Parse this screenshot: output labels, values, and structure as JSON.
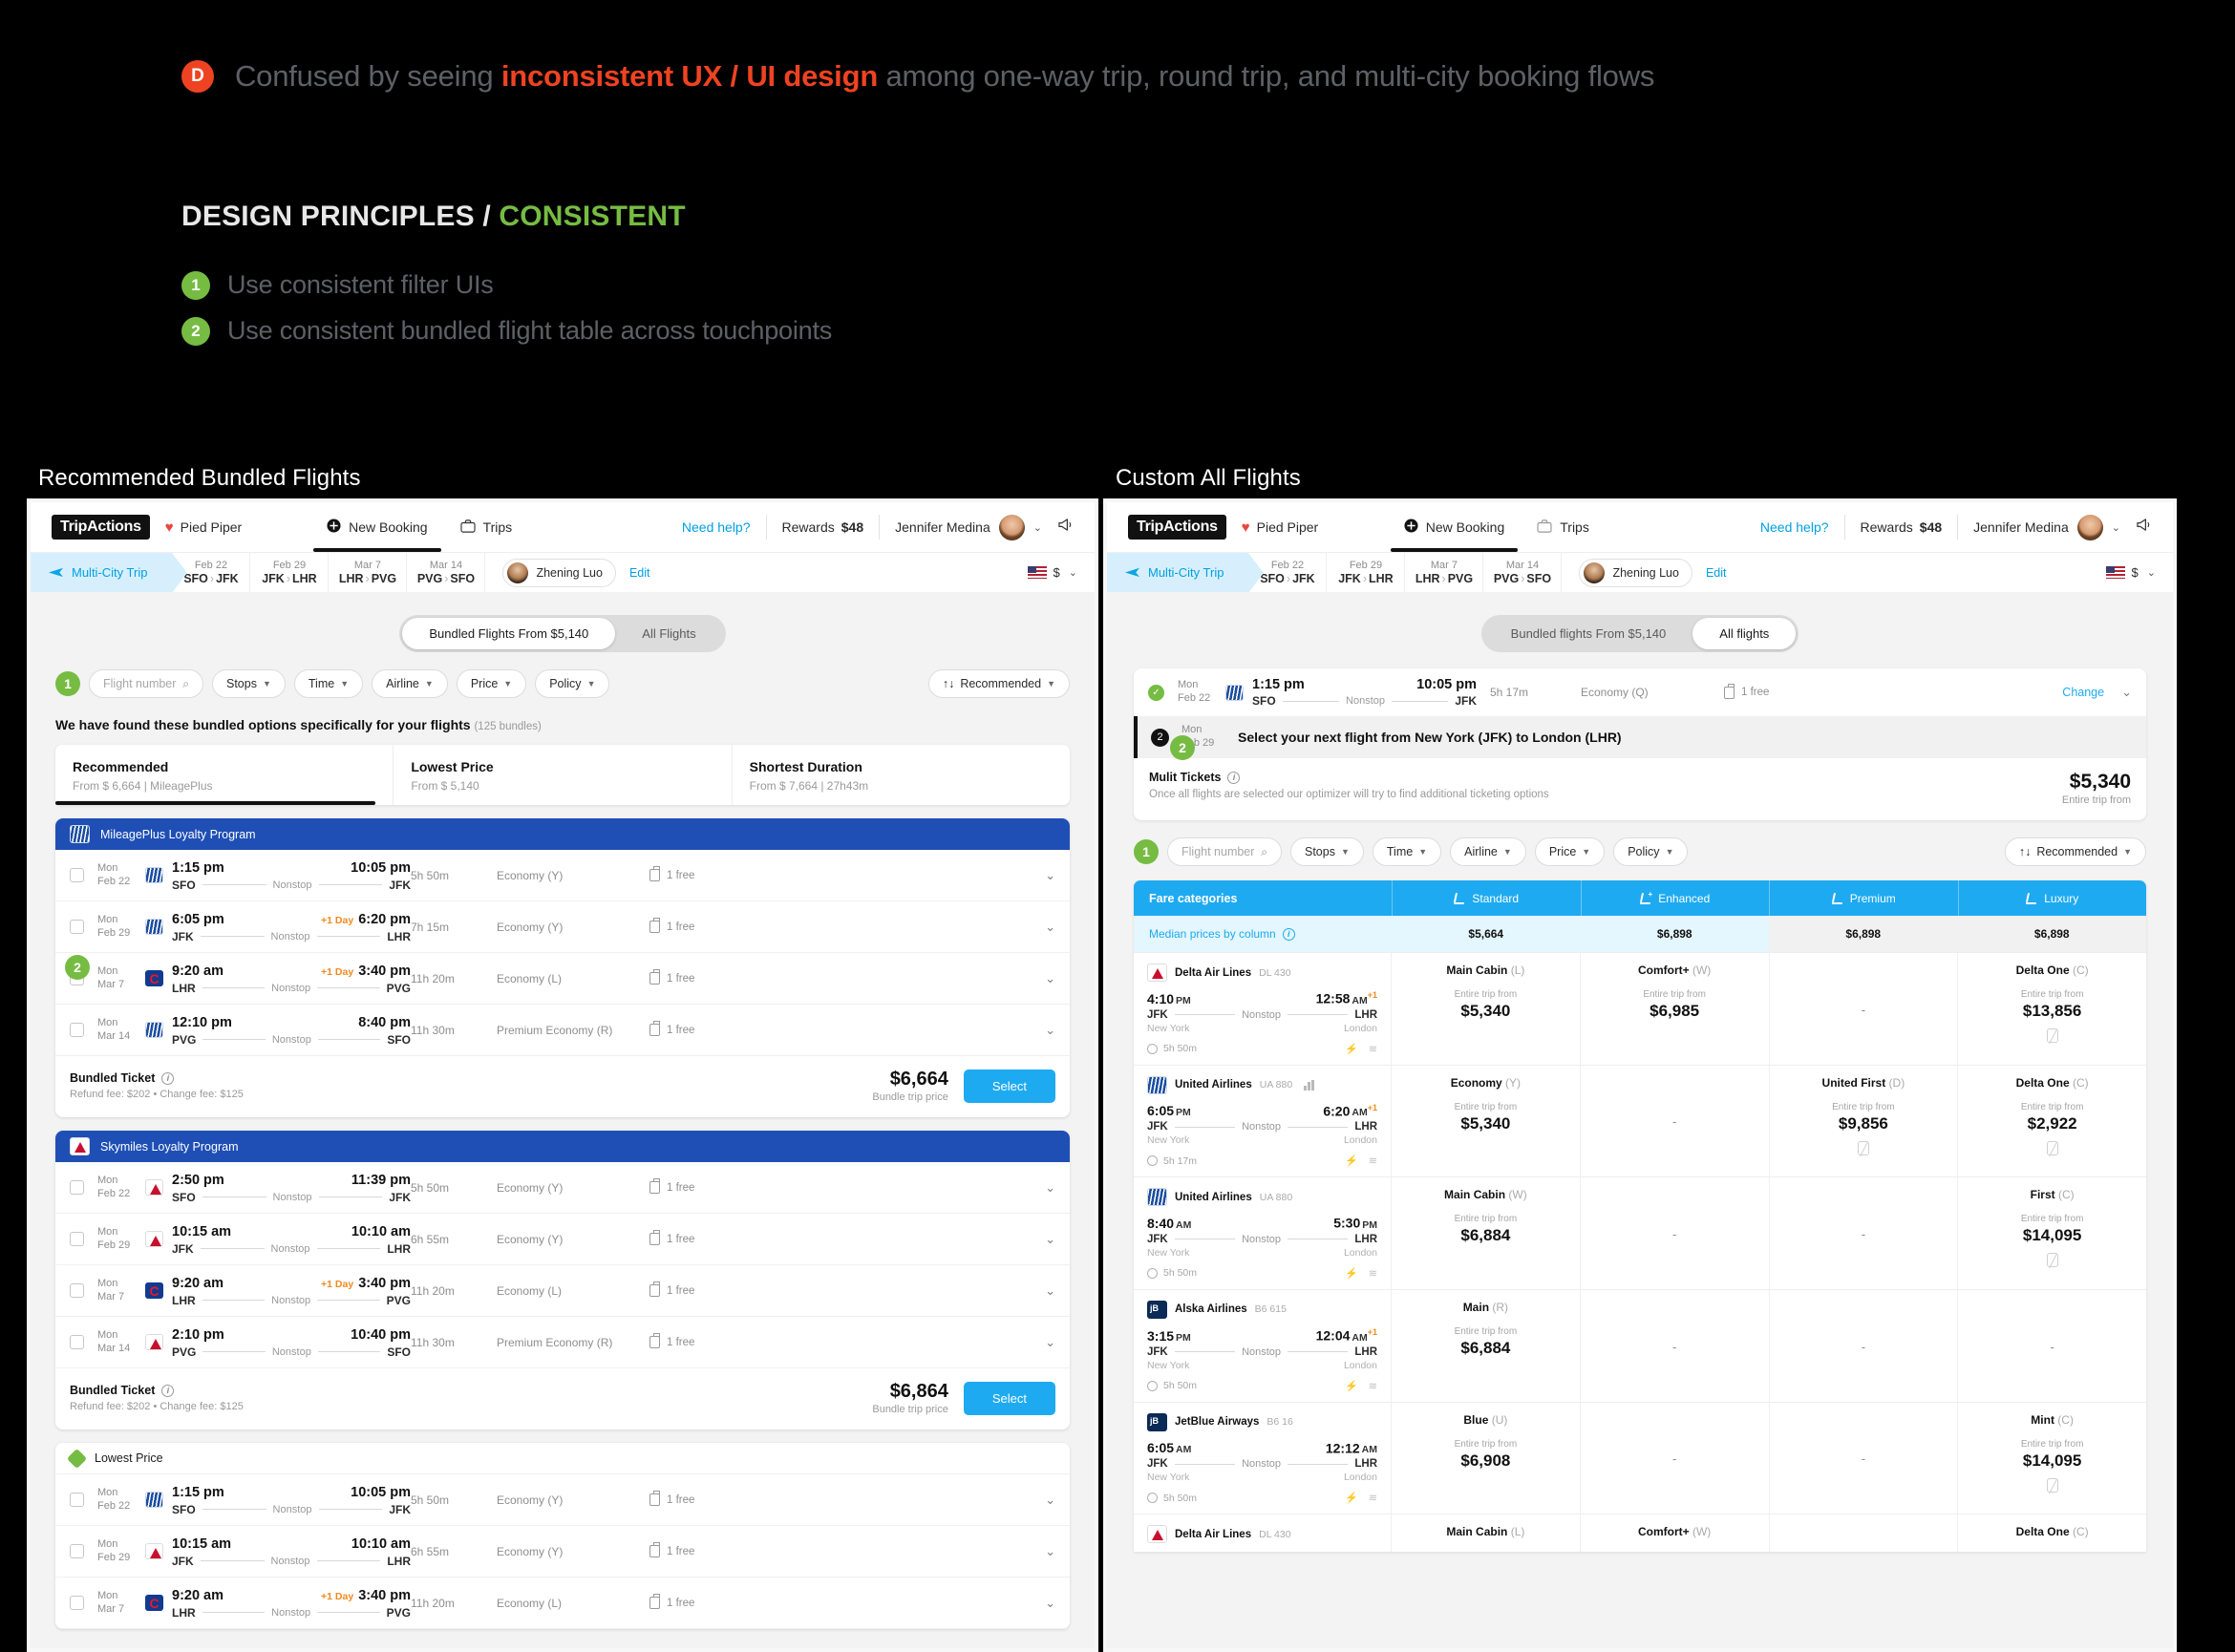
{
  "pain_point": {
    "badge": "D",
    "before": "Confused by seeing ",
    "highlight": "inconsistent UX / UI design",
    "after": " among one-way trip, round trip, and multi-city booking flows"
  },
  "design_principles": {
    "title_prefix": "DESIGN PRINCIPLES / ",
    "title_accent": "CONSISTENT",
    "items": [
      {
        "num": "1",
        "label": "Use consistent filter UIs"
      },
      {
        "num": "2",
        "label": "Use consistent bundled flight table across touchpoints"
      }
    ]
  },
  "captions": {
    "left": "Recommended Bundled Flights",
    "right": "Custom All Flights"
  },
  "colors": {
    "accent_blue": "#1eaaf1",
    "link_blue": "#00a0e3",
    "brand_red": "#ee4322",
    "green": "#76bc43",
    "header_blue": "#1f4fb5",
    "orange": "#f08a1d"
  },
  "appnav": {
    "logo": "TripActions",
    "heart": "♥",
    "company": "Pied Piper",
    "new_booking": "New Booking",
    "trips": "Trips",
    "need_help": "Need help?",
    "rewards_label": "Rewards",
    "rewards_value": "$48",
    "user": "Jennifer Medina",
    "chevron": "⌄",
    "megaphone": "📣"
  },
  "tripbar": {
    "trip_type": "Multi-City Trip",
    "legs": [
      {
        "date": "Feb 22",
        "from": "SFO",
        "to": "JFK"
      },
      {
        "date": "Feb 29",
        "from": "JFK",
        "to": "LHR"
      },
      {
        "date": "Mar 7",
        "from": "LHR",
        "to": "PVG"
      },
      {
        "date": "Mar 14",
        "from": "PVG",
        "to": "SFO"
      }
    ],
    "traveler": "Zhening Luo",
    "edit": "Edit",
    "currency": "$",
    "currency_caret": "⌄"
  },
  "left": {
    "tabs": [
      {
        "label": "Bundled Flights From $5,140",
        "selected": true
      },
      {
        "label": "All Flights",
        "selected": false
      }
    ],
    "badge_one": "1",
    "badge_two": "2",
    "filters": {
      "search_placeholder": "Flight number",
      "search_icon": "⌕",
      "chips": [
        "Stops",
        "Time",
        "Airline",
        "Price",
        "Policy"
      ],
      "sort_label": "Recommended",
      "sort_icon": "↑↓"
    },
    "found_text": "We have found these bundled options specifically for your flights",
    "found_count": "(125 bundles)",
    "sort_summary": [
      {
        "title": "Recommended",
        "sub": "From $ 6,664  |  MileagePlus",
        "active": true
      },
      {
        "title": "Lowest Price",
        "sub": "From $ 5,140",
        "active": false
      },
      {
        "title": "Shortest Duration",
        "sub": "From $ 7,664  |  27h43m",
        "active": false
      }
    ],
    "cards": [
      {
        "header": "MileagePlus Loyalty Program",
        "header_style": "blue",
        "logo": "logo-ua",
        "rows": [
          {
            "day": "Mon",
            "date": "Feb 22",
            "logo": "logo-ua",
            "dep": "1:15 pm",
            "arr": "10:05 pm",
            "plus": "",
            "from": "SFO",
            "to": "JFK",
            "stops": "Nonstop",
            "dur": "5h 50m",
            "cabin": "Economy (Y)",
            "bag": "1 free"
          },
          {
            "day": "Mon",
            "date": "Feb 29",
            "logo": "logo-ua",
            "dep": "6:05 pm",
            "arr": "6:20 pm",
            "plus": "+1 Day",
            "from": "JFK",
            "to": "LHR",
            "stops": "Nonstop",
            "dur": "7h 15m",
            "cabin": "Economy (Y)",
            "bag": "1 free"
          },
          {
            "day": "Mon",
            "date": "Mar 7",
            "logo": "logo-mu",
            "dep": "9:20 am",
            "arr": "3:40 pm",
            "plus": "+1 Day",
            "from": "LHR",
            "to": "PVG",
            "stops": "Nonstop",
            "dur": "11h 20m",
            "cabin": "Economy (L)",
            "bag": "1 free"
          },
          {
            "day": "Mon",
            "date": "Mar 14",
            "logo": "logo-ua",
            "dep": "12:10 pm",
            "arr": "8:40 pm",
            "plus": "",
            "from": "PVG",
            "to": "SFO",
            "stops": "Nonstop",
            "dur": "11h 30m",
            "cabin": "Premium Economy (R)",
            "bag": "1 free"
          }
        ],
        "foot_label": "Bundled Ticket",
        "fees": "Refund fee: $202 • Change fee: $125",
        "price": "$6,664",
        "price_sub": "Bundle trip price",
        "select": "Select"
      },
      {
        "header": "Skymiles Loyalty Program",
        "header_style": "blue",
        "logo": "logo-dl",
        "rows": [
          {
            "day": "Mon",
            "date": "Feb 22",
            "logo": "logo-dl",
            "dep": "2:50 pm",
            "arr": "11:39 pm",
            "plus": "",
            "from": "SFO",
            "to": "JFK",
            "stops": "Nonstop",
            "dur": "5h 50m",
            "cabin": "Economy (Y)",
            "bag": "1 free"
          },
          {
            "day": "Mon",
            "date": "Feb 29",
            "logo": "logo-dl",
            "dep": "10:15 am",
            "arr": "10:10 am",
            "plus": "",
            "from": "JFK",
            "to": "LHR",
            "stops": "Nonstop",
            "dur": "6h 55m",
            "cabin": "Economy (Y)",
            "bag": "1 free"
          },
          {
            "day": "Mon",
            "date": "Mar 7",
            "logo": "logo-mu",
            "dep": "9:20 am",
            "arr": "3:40 pm",
            "plus": "+1 Day",
            "from": "LHR",
            "to": "PVG",
            "stops": "Nonstop",
            "dur": "11h 20m",
            "cabin": "Economy (L)",
            "bag": "1 free"
          },
          {
            "day": "Mon",
            "date": "Mar 14",
            "logo": "logo-dl",
            "dep": "2:10 pm",
            "arr": "10:40 pm",
            "plus": "",
            "from": "PVG",
            "to": "SFO",
            "stops": "Nonstop",
            "dur": "11h 30m",
            "cabin": "Premium Economy (R)",
            "bag": "1 free"
          }
        ],
        "foot_label": "Bundled Ticket",
        "fees": "Refund fee: $202 • Change fee: $125",
        "price": "$6,864",
        "price_sub": "Bundle trip price",
        "select": "Select"
      },
      {
        "header": "Lowest Price",
        "header_style": "plain",
        "logo": "diamond",
        "rows": [
          {
            "day": "Mon",
            "date": "Feb 22",
            "logo": "logo-ua",
            "dep": "1:15 pm",
            "arr": "10:05 pm",
            "plus": "",
            "from": "SFO",
            "to": "JFK",
            "stops": "Nonstop",
            "dur": "5h 50m",
            "cabin": "Economy (Y)",
            "bag": "1 free"
          },
          {
            "day": "Mon",
            "date": "Feb 29",
            "logo": "logo-dl",
            "dep": "10:15 am",
            "arr": "10:10 am",
            "plus": "",
            "from": "JFK",
            "to": "LHR",
            "stops": "Nonstop",
            "dur": "6h 55m",
            "cabin": "Economy (Y)",
            "bag": "1 free"
          },
          {
            "day": "Mon",
            "date": "Mar 7",
            "logo": "logo-mu",
            "dep": "9:20 am",
            "arr": "3:40 pm",
            "plus": "+1 Day",
            "from": "LHR",
            "to": "PVG",
            "stops": "Nonstop",
            "dur": "11h 20m",
            "cabin": "Economy (L)",
            "bag": "1 free"
          }
        ]
      }
    ]
  },
  "right": {
    "tabs": [
      {
        "label": "Bundled flights From $5,140",
        "selected": false
      },
      {
        "label": "All flights",
        "selected": true
      }
    ],
    "badge_one": "1",
    "badge_two": "2",
    "selected_flight": {
      "day": "Mon",
      "date": "Feb 22",
      "dep": "1:15 pm",
      "arr": "10:05 pm",
      "from": "SFO",
      "to": "JFK",
      "stops": "Nonstop",
      "dur": "5h 17m",
      "cabin": "Economy (Q)",
      "bag": "1 free",
      "change": "Change",
      "chevron": "⌄"
    },
    "next_step": {
      "num": "2",
      "day": "Mon",
      "date": "Feb 29",
      "text": "Select your next flight from New York (JFK) to London (LHR)"
    },
    "multi_tickets": {
      "label": "Mulit Tickets",
      "note": "Once all flights are selected our optimizer will try to find additional ticketing options",
      "price": "$5,340",
      "price_sub": "Entire trip from"
    },
    "filters": {
      "search_placeholder": "Flight number",
      "search_icon": "⌕",
      "chips": [
        "Stops",
        "Time",
        "Airline",
        "Price",
        "Policy"
      ],
      "sort_label": "Recommended",
      "sort_icon": "↑↓"
    },
    "fare_table": {
      "col0_header": "Fare categories",
      "columns": [
        "Standard",
        "Enhanced",
        "Premium",
        "Luxury"
      ],
      "median_label": "Median prices by column",
      "median_values": [
        "$5,664",
        "$6,898",
        "$6,898",
        "$6,898"
      ],
      "rows": [
        {
          "airline": "Delta Air Lines",
          "flight_no": "DL 430",
          "logo": "logo-dl",
          "bars": false,
          "dep": "4:10",
          "dep_ampm": "PM",
          "arr": "12:58",
          "arr_ampm": "AM",
          "arr_plus": "+1",
          "from": "JFK",
          "to": "LHR",
          "stops": "Nonstop",
          "from_city": "New York",
          "to_city": "London",
          "dur": "5h 50m",
          "cells": [
            {
              "name": "Main Cabin",
              "cls": "(L)",
              "from_label": "Entire trip from",
              "price": "$5,340",
              "norefund": false
            },
            {
              "name": "Comfort+",
              "cls": "(W)",
              "from_label": "Entire trip from",
              "price": "$6,985",
              "norefund": false
            },
            {
              "dash": "-"
            },
            {
              "name": "Delta One",
              "cls": "(C)",
              "from_label": "Entire trip from",
              "price": "$13,856",
              "norefund": true
            }
          ]
        },
        {
          "airline": "United Airlines",
          "flight_no": "UA 880",
          "logo": "logo-ua",
          "bars": true,
          "dep": "6:05",
          "dep_ampm": "PM",
          "arr": "6:20",
          "arr_ampm": "AM",
          "arr_plus": "+1",
          "from": "JFK",
          "to": "LHR",
          "stops": "Nonstop",
          "from_city": "New York",
          "to_city": "London",
          "dur": "5h 17m",
          "cells": [
            {
              "name": "Economy",
              "cls": "(Y)",
              "from_label": "Entire trip from",
              "price": "$5,340",
              "norefund": false
            },
            {
              "dash": "-"
            },
            {
              "name": "United First",
              "cls": "(D)",
              "from_label": "Entire trip from",
              "price": "$9,856",
              "norefund": true
            },
            {
              "name": "Delta One",
              "cls": "(C)",
              "from_label": "Entire trip from",
              "price": "$2,922",
              "norefund": true
            }
          ]
        },
        {
          "airline": "United Airlines",
          "flight_no": "UA 880",
          "logo": "logo-ua",
          "bars": false,
          "dep": "8:40",
          "dep_ampm": "AM",
          "arr": "5:30",
          "arr_ampm": "PM",
          "arr_plus": "",
          "from": "JFK",
          "to": "LHR",
          "stops": "Nonstop",
          "from_city": "New York",
          "to_city": "London",
          "dur": "5h 50m",
          "cells": [
            {
              "name": "Main Cabin",
              "cls": "(W)",
              "from_label": "Entire trip from",
              "price": "$6,884",
              "norefund": false
            },
            {
              "dash": "-"
            },
            {
              "dash": "-"
            },
            {
              "name": "First",
              "cls": "(C)",
              "from_label": "Entire trip from",
              "price": "$14,095",
              "norefund": true
            }
          ]
        },
        {
          "airline": "Alska Airlines",
          "flight_no": "B6 615",
          "logo": "logo-as",
          "bars": false,
          "dep": "3:15",
          "dep_ampm": "PM",
          "arr": "12:04",
          "arr_ampm": "AM",
          "arr_plus": "+1",
          "from": "JFK",
          "to": "LHR",
          "stops": "Nonstop",
          "from_city": "New York",
          "to_city": "London",
          "dur": "5h 50m",
          "cells": [
            {
              "name": "Main",
              "cls": "(R)",
              "from_label": "Entire trip from",
              "price": "$6,884",
              "norefund": false
            },
            {
              "dash": "-"
            },
            {
              "dash": "-"
            },
            {
              "dash": "-"
            }
          ]
        },
        {
          "airline": "JetBlue Airways",
          "flight_no": "B6 16",
          "logo": "logo-b6",
          "bars": false,
          "dep": "6:05",
          "dep_ampm": "AM",
          "arr": "12:12",
          "arr_ampm": "AM",
          "arr_plus": "",
          "from": "JFK",
          "to": "LHR",
          "stops": "Nonstop",
          "from_city": "New York",
          "to_city": "London",
          "dur": "5h 50m",
          "cells": [
            {
              "name": "Blue",
              "cls": "(U)",
              "from_label": "Entire trip from",
              "price": "$6,908",
              "norefund": false
            },
            {
              "dash": "-"
            },
            {
              "dash": "-"
            },
            {
              "name": "Mint",
              "cls": "(C)",
              "from_label": "Entire trip from",
              "price": "$14,095",
              "norefund": true
            }
          ]
        },
        {
          "airline": "Delta Air Lines",
          "flight_no": "DL 430",
          "logo": "logo-dl",
          "bars": false,
          "partial": true,
          "cells": [
            {
              "name": "Main Cabin",
              "cls": "(L)"
            },
            {
              "name": "Comfort+",
              "cls": "(W)"
            },
            {
              "dash": ""
            },
            {
              "name": "Delta One",
              "cls": "(C)"
            }
          ]
        }
      ]
    }
  }
}
